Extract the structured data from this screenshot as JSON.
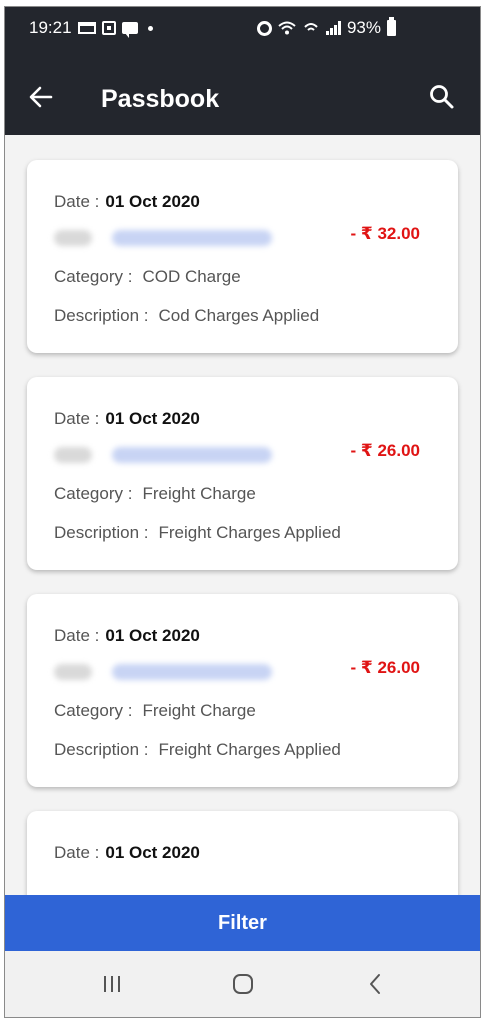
{
  "status_bar": {
    "time": "19:21",
    "battery": "93%"
  },
  "app_bar": {
    "title": "Passbook",
    "back_icon": "arrow-left-icon",
    "search_icon": "search-icon"
  },
  "labels": {
    "date": "Date :",
    "category": "Category :",
    "description": "Description :"
  },
  "transactions": [
    {
      "date": "01 Oct 2020",
      "amount": "- ₹ 32.00",
      "category": "COD Charge",
      "description": "Cod Charges Applied"
    },
    {
      "date": "01 Oct 2020",
      "amount": "- ₹ 26.00",
      "category": "Freight Charge",
      "description": "Freight Charges Applied"
    },
    {
      "date": "01 Oct 2020",
      "amount": "- ₹ 26.00",
      "category": "Freight Charge",
      "description": "Freight Charges Applied"
    },
    {
      "date": "01 Oct 2020"
    }
  ],
  "filter_button": {
    "label": "Filter"
  },
  "colors": {
    "app_bar": "#23262d",
    "amount_debit": "#e01414",
    "filter_button": "#2f64d6"
  },
  "nav_bar": {
    "recent_icon": "recent-apps-icon",
    "home_icon": "home-icon",
    "back_icon": "back-icon"
  }
}
